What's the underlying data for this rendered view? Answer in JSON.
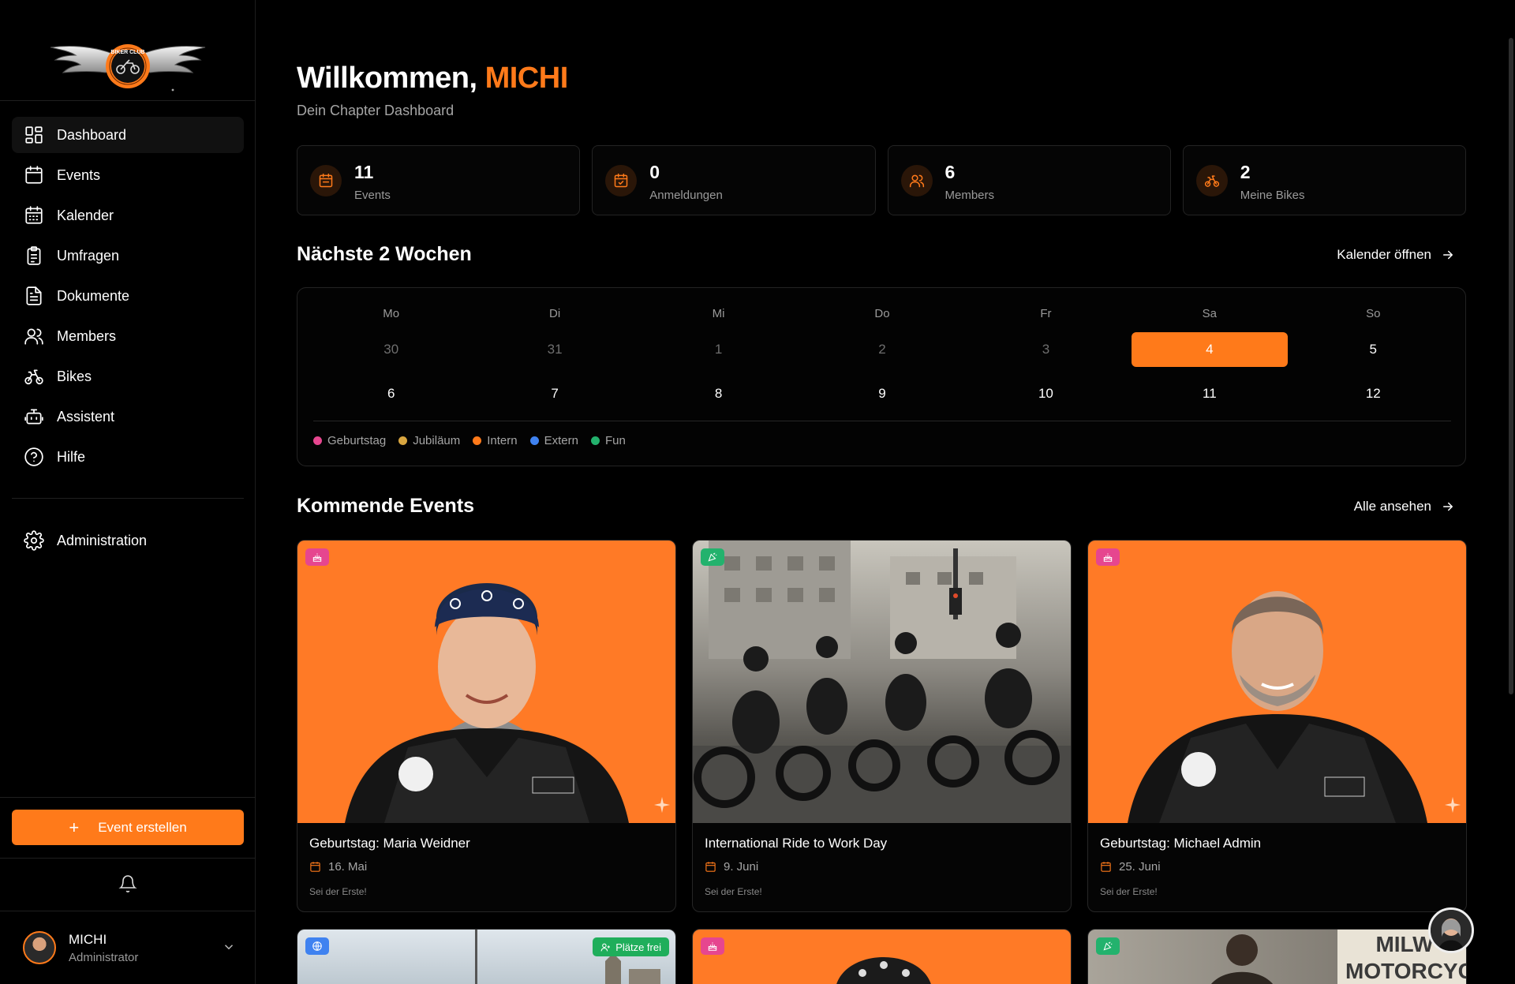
{
  "sidebar": {
    "logo_text": "BIKER CLUB",
    "nav": [
      {
        "label": "Dashboard",
        "icon": "grid-icon",
        "active": true
      },
      {
        "label": "Events",
        "icon": "calendar-icon"
      },
      {
        "label": "Kalender",
        "icon": "calendar-grid-icon"
      },
      {
        "label": "Umfragen",
        "icon": "clipboard-icon"
      },
      {
        "label": "Dokumente",
        "icon": "document-icon"
      },
      {
        "label": "Members",
        "icon": "users-icon"
      },
      {
        "label": "Bikes",
        "icon": "bike-icon"
      },
      {
        "label": "Assistent",
        "icon": "bot-icon"
      },
      {
        "label": "Hilfe",
        "icon": "help-icon"
      }
    ],
    "admin_label": "Administration",
    "create_label": "Event erstellen",
    "user": {
      "name": "MICHI",
      "role": "Administrator"
    }
  },
  "header": {
    "greeting": "Willkommen,",
    "name": "MICHI",
    "subtitle": "Dein Chapter Dashboard"
  },
  "stats": [
    {
      "value": "11",
      "label": "Events",
      "icon": "calendar-icon"
    },
    {
      "value": "0",
      "label": "Anmeldungen",
      "icon": "calendar-check-icon"
    },
    {
      "value": "6",
      "label": "Members",
      "icon": "users-icon"
    },
    {
      "value": "2",
      "label": "Meine Bikes",
      "icon": "bike-icon"
    }
  ],
  "calendar": {
    "title": "Nächste 2 Wochen",
    "link": "Kalender öffnen",
    "weekdays": [
      "Mo",
      "Di",
      "Mi",
      "Do",
      "Fr",
      "Sa",
      "So"
    ],
    "week1": [
      "30",
      "31",
      "1",
      "2",
      "3",
      "4",
      "5"
    ],
    "week2": [
      "6",
      "7",
      "8",
      "9",
      "10",
      "11",
      "12"
    ],
    "legend": [
      {
        "label": "Geburtstag",
        "color": "#e6468f"
      },
      {
        "label": "Jubiläum",
        "color": "#d9a640"
      },
      {
        "label": "Intern",
        "color": "#ff7a1a"
      },
      {
        "label": "Extern",
        "color": "#3f82f0"
      },
      {
        "label": "Fun",
        "color": "#23b26d"
      }
    ]
  },
  "events": {
    "title": "Kommende Events",
    "link": "Alle ansehen",
    "cards": [
      {
        "title": "Geburtstag: Maria Weidner",
        "date": "16. Mai",
        "note": "Sei der Erste!",
        "tag_color": "#e6468f"
      },
      {
        "title": "International Ride to Work Day",
        "date": "9. Juni",
        "note": "Sei der Erste!",
        "tag_color": "#23b26d"
      },
      {
        "title": "Geburtstag: Michael Admin",
        "date": "25. Juni",
        "note": "Sei der Erste!",
        "tag_color": "#e6468f"
      }
    ],
    "free_badge": "Plätze frei",
    "sign_text": "MILW MOTORCYCL"
  }
}
